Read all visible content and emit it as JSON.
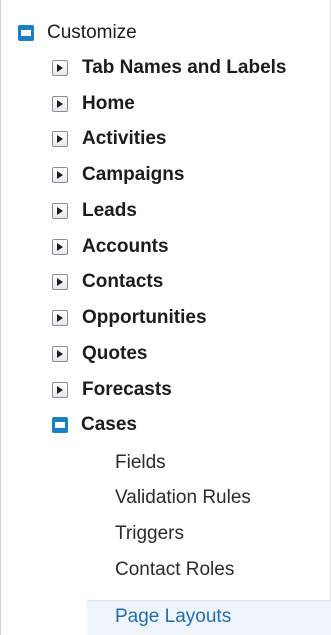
{
  "tree": {
    "root": {
      "label": "Customize",
      "expanded": true
    },
    "items": [
      {
        "label": "Tab Names and Labels",
        "expanded": false
      },
      {
        "label": "Home",
        "expanded": false
      },
      {
        "label": "Activities",
        "expanded": false
      },
      {
        "label": "Campaigns",
        "expanded": false
      },
      {
        "label": "Leads",
        "expanded": false
      },
      {
        "label": "Accounts",
        "expanded": false
      },
      {
        "label": "Contacts",
        "expanded": false
      },
      {
        "label": "Opportunities",
        "expanded": false
      },
      {
        "label": "Quotes",
        "expanded": false
      },
      {
        "label": "Forecasts",
        "expanded": false
      },
      {
        "label": "Cases",
        "expanded": true
      }
    ],
    "cases_children": [
      {
        "label": "Fields"
      },
      {
        "label": "Validation Rules"
      },
      {
        "label": "Triggers"
      },
      {
        "label": "Contact Roles"
      },
      {
        "label": "Page Layouts",
        "selected": true
      }
    ]
  },
  "icons": {
    "expanded": "collapse-toggle-icon",
    "collapsed": "expand-toggle-icon"
  },
  "colors": {
    "accent": "#1a7fc3",
    "link": "#1f6fb0",
    "selected_bg": "#eef4fa"
  }
}
